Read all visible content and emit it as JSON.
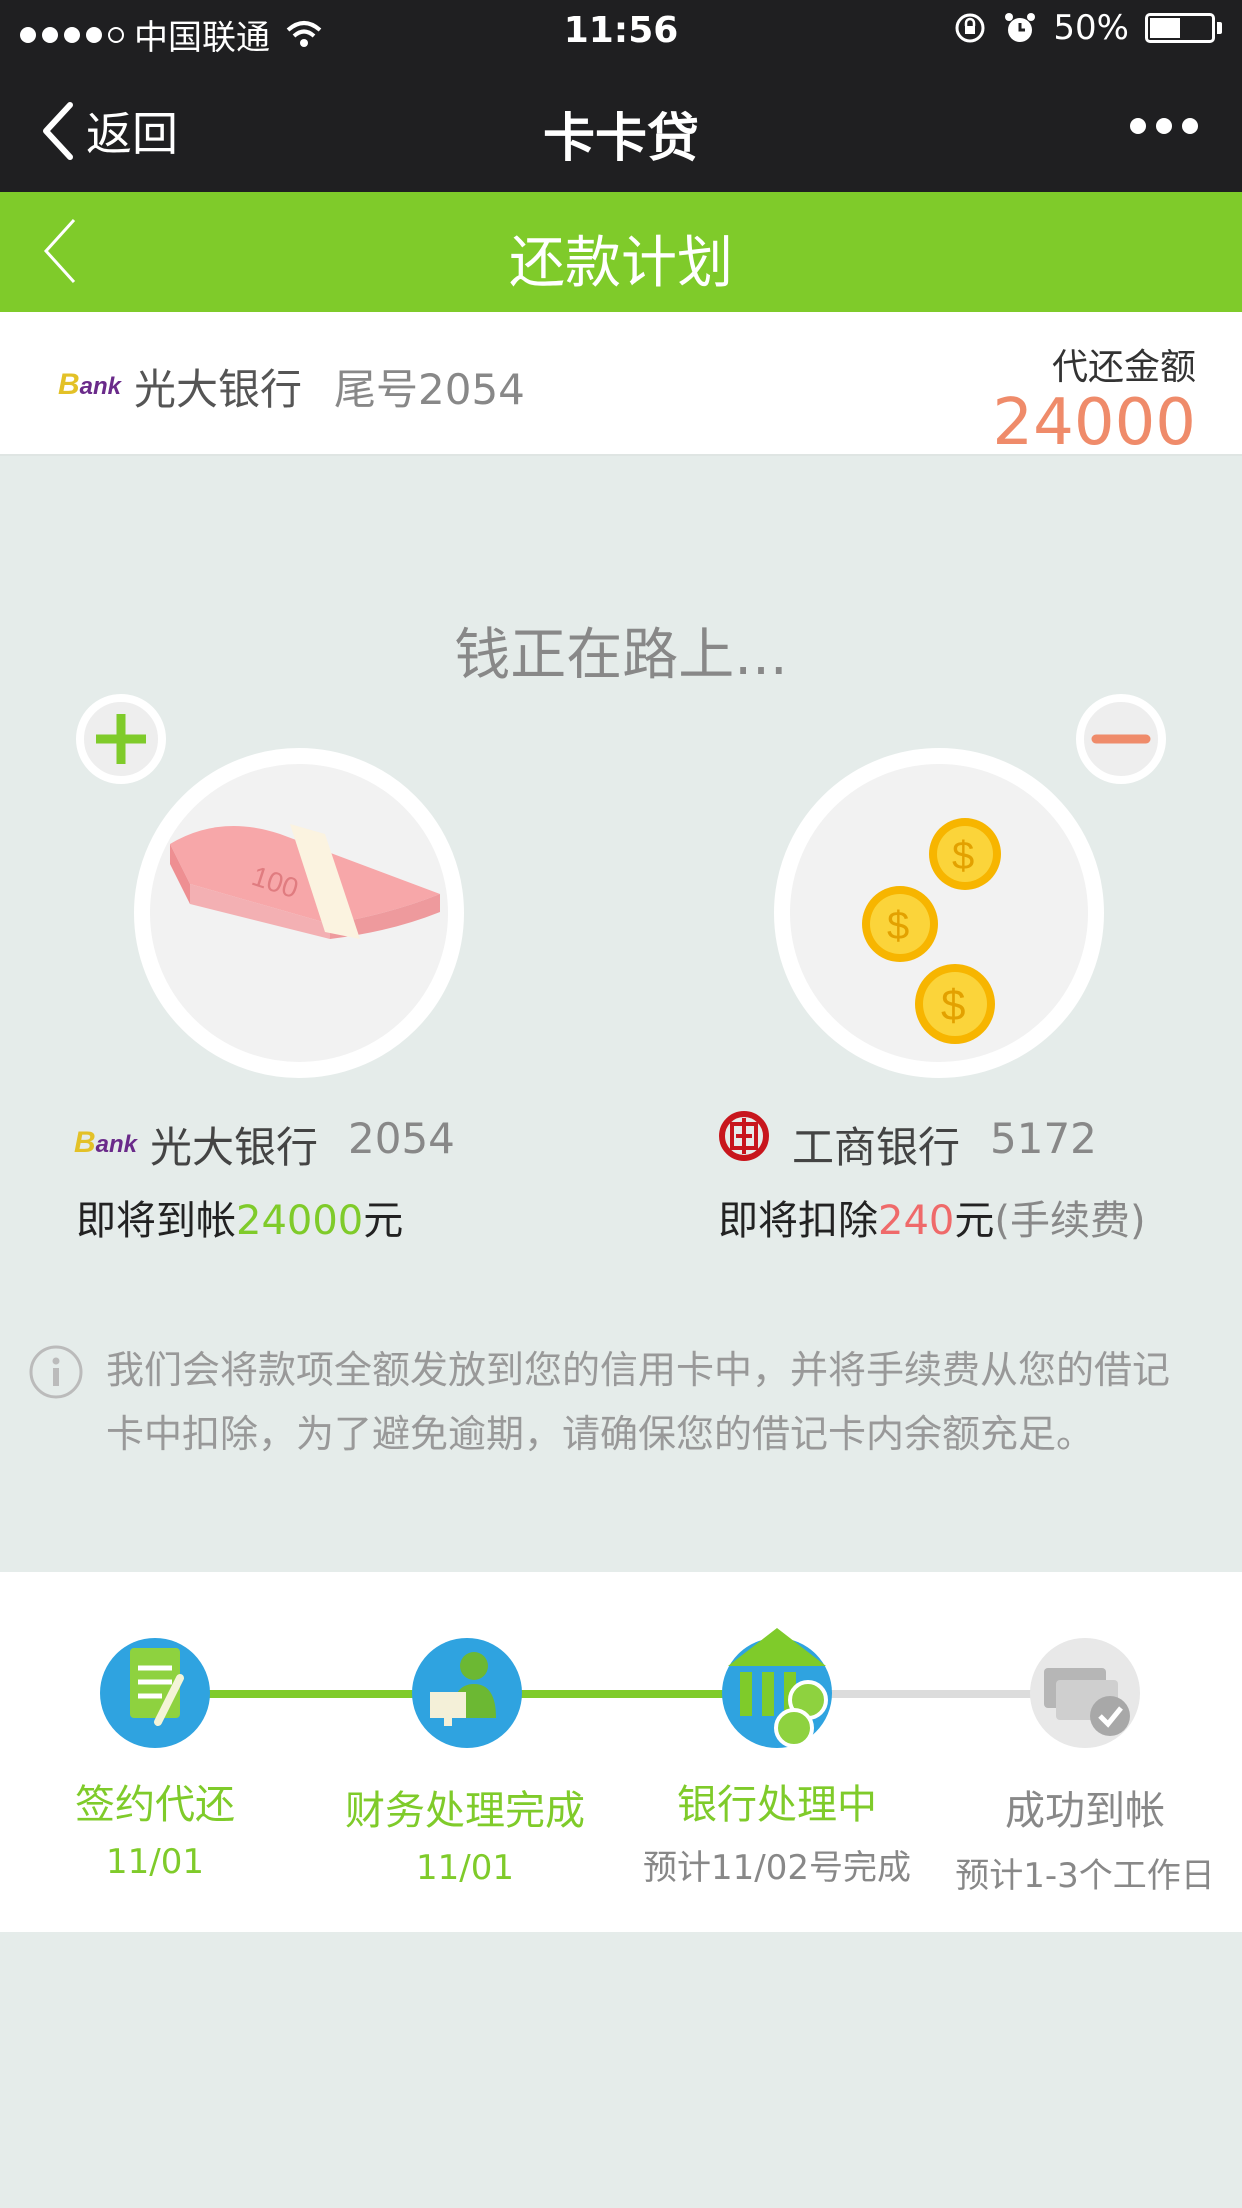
{
  "status_bar": {
    "carrier": "中国联通",
    "time": "11:56",
    "battery": "50%",
    "battery_level": 0.5
  },
  "nav": {
    "back_label": "返回",
    "title": "卡卡贷"
  },
  "header": {
    "title": "还款计划"
  },
  "account": {
    "bank": "光大银行",
    "tail": "尾号2054",
    "amount_label": "代还金额",
    "amount": "24000"
  },
  "status_text": "钱正在路上...",
  "bank_logo_text": "Bank",
  "incoming": {
    "bank": "光大银行",
    "number": "2054",
    "prefix": "即将到帐",
    "amount": "24000",
    "suffix": "元"
  },
  "outgoing": {
    "bank": "工商银行",
    "number": "5172",
    "prefix": "即将扣除",
    "amount": "240",
    "suffix": "元",
    "note": "(手续费)"
  },
  "notice": "我们会将款项全额发放到您的信用卡中，并将手续费从您的借记卡中扣除，为了避免逾期，请确保您的借记卡内余额充足。",
  "steps": [
    {
      "label": "签约代还",
      "sub": "11/01",
      "state": "done"
    },
    {
      "label": "财务处理完成",
      "sub": "11/01",
      "state": "done"
    },
    {
      "label": "银行处理中",
      "sub": "预计11/02号完成",
      "state": "active"
    },
    {
      "label": "成功到帐",
      "sub": "预计1-3个工作日",
      "state": "pending"
    }
  ],
  "colors": {
    "green": "#7fcb2a",
    "orange": "#ef8b6a",
    "red": "#ef6a6a",
    "dark": "#1f1f21",
    "background": "#e5ecea"
  }
}
